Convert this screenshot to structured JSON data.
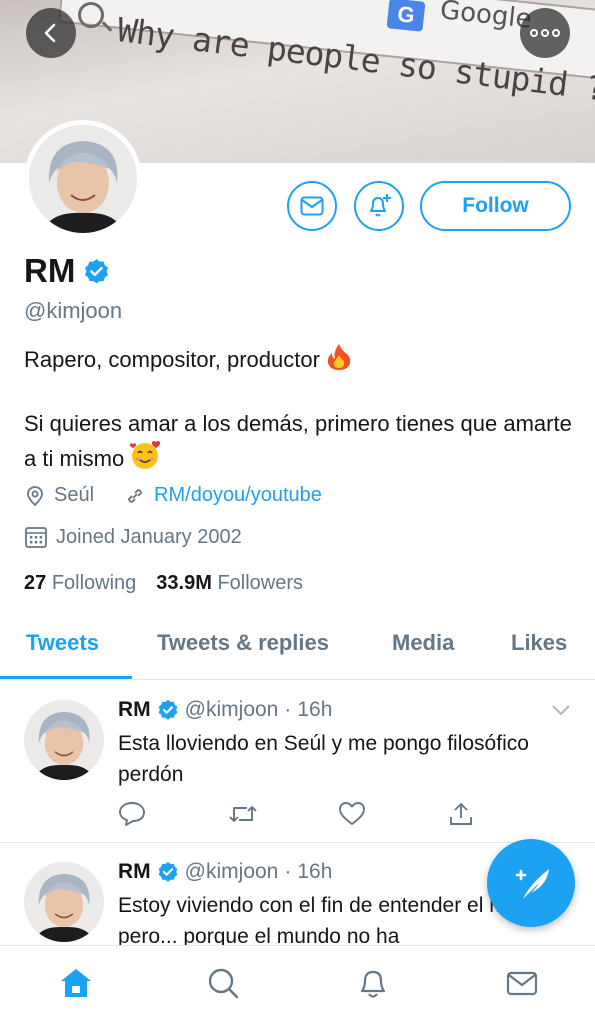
{
  "banner": {
    "search_query": "Why are people so stupid ?",
    "google_badge": "G",
    "google_text": "Google"
  },
  "profile": {
    "name": "RM",
    "handle": "@kimjoon",
    "bio_line1": "Rapero, compositor, productor",
    "bio_line2": "Si quieres amar a los demás, primero tienes que amarte a ti mismo",
    "location": "Seúl",
    "website": "RM/doyou/youtube",
    "joined": "Joined January 2002",
    "following_count": "27",
    "following_label": "Following",
    "followers_count": "33.9M",
    "followers_label": "Followers",
    "follow_button": "Follow"
  },
  "tabs": [
    {
      "label": "Tweets",
      "active": true
    },
    {
      "label": "Tweets & replies",
      "active": false
    },
    {
      "label": "Media",
      "active": false
    },
    {
      "label": "Likes",
      "active": false
    }
  ],
  "tweets": [
    {
      "name": "RM",
      "handle": "@kimjoon",
      "time": "16h",
      "text": "Esta lloviendo en Seúl y me pongo filosófico perdón"
    },
    {
      "name": "RM",
      "handle": "@kimjoon",
      "time": "16h",
      "text": "Estoy viviendo con el fin de entender el mundo, pero... porque el mundo no ha"
    }
  ],
  "colors": {
    "accent": "#1da1f2",
    "muted": "#657786",
    "text": "#14171a",
    "border": "#e1e8ed"
  },
  "icons": {
    "back": "chevron-left-icon",
    "more": "more-dots-icon",
    "message": "envelope-icon",
    "notify": "bell-plus-icon",
    "verified": "verified-badge-icon",
    "location": "location-pin-icon",
    "link": "link-icon",
    "calendar": "calendar-icon",
    "reply": "reply-icon",
    "retweet": "retweet-icon",
    "like": "heart-icon",
    "share": "share-icon",
    "compose": "compose-feather-icon",
    "home": "home-icon",
    "search": "search-icon",
    "notifications": "bell-icon",
    "messages": "mail-icon"
  }
}
